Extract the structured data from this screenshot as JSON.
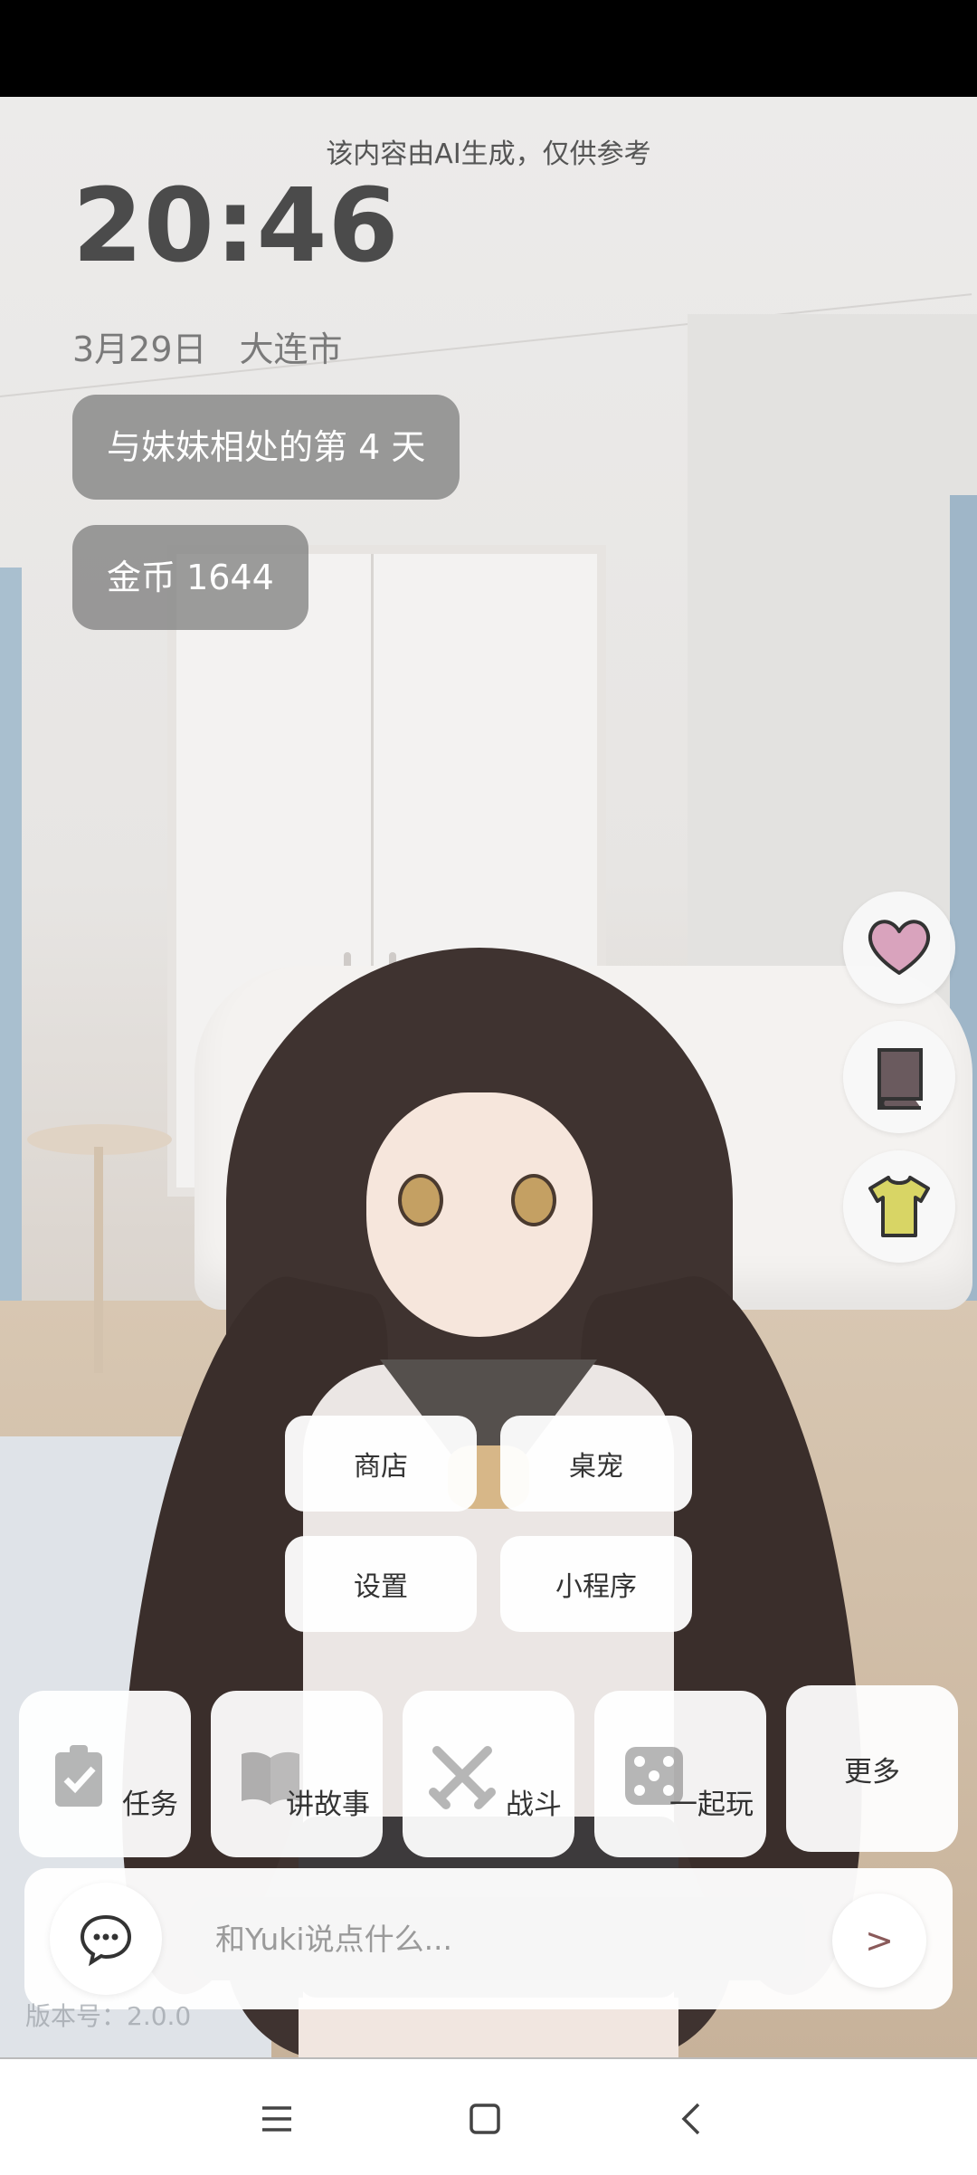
{
  "notice": "该内容由AI生成，仅供参考",
  "clock": "20:46",
  "date": "3月29日",
  "city": "大连市",
  "days_pill": "与妹妹相处的第 4 天",
  "coins_pill": "金币 1644",
  "side_icons": [
    "heart-icon",
    "book-icon",
    "shirt-icon"
  ],
  "menu": {
    "shop": "商店",
    "desktop_pet": "桌宠",
    "settings": "设置",
    "mini_program": "小程序"
  },
  "actions": {
    "tasks": "任务",
    "story": "讲故事",
    "battle": "战斗",
    "play": "一起玩",
    "more": "更多"
  },
  "chat": {
    "placeholder": "和Yuki说点什么...",
    "send": ">"
  },
  "version": "版本号：2.0.0",
  "colors": {
    "heart": "#d9a3bd",
    "book": "#6a5a5e",
    "shirt": "#d8d565",
    "pill_bg": "#7a7a7a"
  }
}
